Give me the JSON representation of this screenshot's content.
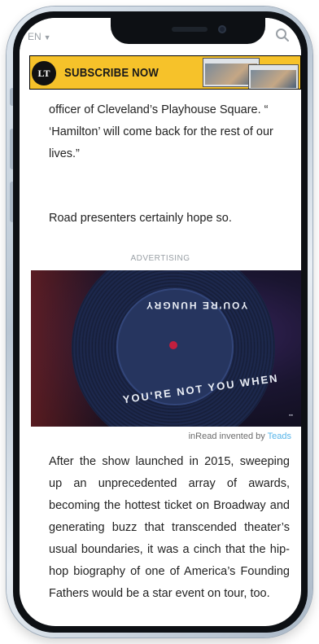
{
  "nav": {
    "language": "EN",
    "search_icon": "search-icon"
  },
  "banner": {
    "logo_text": "LT",
    "cta": "SUBSCRIBE NOW",
    "color": "#f6c22a"
  },
  "article": {
    "paragraph_1": "officer of Cleveland’s Playhouse Square. “ ‘Hamilton’ will come back for the rest of our lives.”",
    "paragraph_2": "Road presenters certainly hope so.",
    "ad_label": "ADVERTISING",
    "ad_credit_prefix": "inRead invented by",
    "ad_credit_brand": "Teads",
    "paragraph_3": "After the show launched in 2015, sweeping up an unprecedented array of awards, becoming the hottest ticket on Broadway and generating buzz that transcended theater’s usual boundaries, it was a cinch that the hip-hop biography of one of America’s Founding Fathers would be a star event on tour, too."
  },
  "ad": {
    "record_text_top": "YOU'RE HUNGRY",
    "record_text_bottom": "YOU'RE NOT YOU WHEN"
  }
}
